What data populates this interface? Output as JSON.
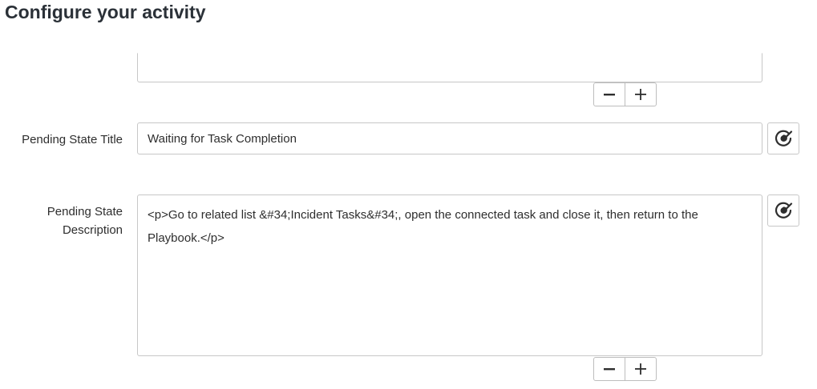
{
  "page": {
    "title": "Configure your activity"
  },
  "top_field": {
    "value": ""
  },
  "pending_state_title": {
    "label": "Pending State Title",
    "value": "Waiting for Task Completion"
  },
  "pending_state_description": {
    "label_line1": "Pending State",
    "label_line2": "Description",
    "value": "<p>Go to related list &#34;Incident Tasks&#34;, open the connected task and close it, then return to the Playbook.</p>"
  },
  "stepper": {
    "minus_icon": "minus-icon",
    "plus_icon": "plus-icon"
  },
  "icons": {
    "data_pill_picker": "pill-picker-icon"
  },
  "colors": {
    "title": "#2b3138",
    "text": "#2e2e2e",
    "border": "#c7c7c7"
  }
}
